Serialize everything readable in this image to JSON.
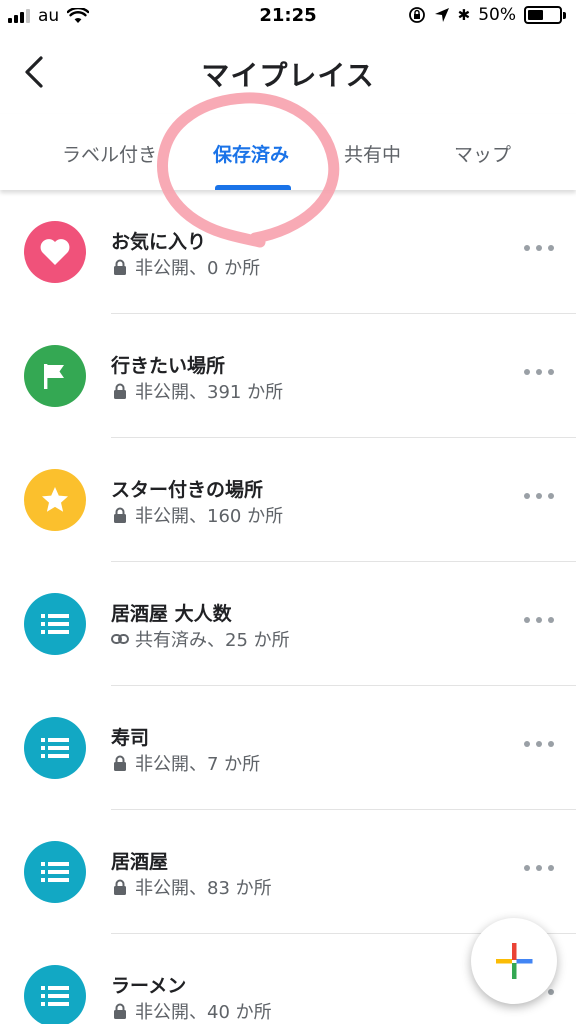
{
  "status_bar": {
    "carrier": "au",
    "time": "21:25",
    "battery_percent": "50%",
    "battery_level": 0.5
  },
  "header": {
    "title": "マイプレイス",
    "back_icon": "chevron-left-icon"
  },
  "tabs": [
    {
      "label": "ラベル付き",
      "active": false
    },
    {
      "label": "保存済み",
      "active": true
    },
    {
      "label": "共有中",
      "active": false
    },
    {
      "label": "マップ",
      "active": false
    }
  ],
  "colors": {
    "accent": "#1a73e8",
    "favorites": "#f0527a",
    "want_to_go": "#34a853",
    "starred": "#fbc02d",
    "custom_list": "#12a8c4",
    "annotation_circle": "#f7a1ad"
  },
  "lists": [
    {
      "title": "お気に入り",
      "subtitle": "非公開、0 か所",
      "icon": "heart-icon",
      "sub_icon": "lock-icon",
      "color": "#f0527a"
    },
    {
      "title": "行きたい場所",
      "subtitle": "非公開、391 か所",
      "icon": "flag-icon",
      "sub_icon": "lock-icon",
      "color": "#34a853"
    },
    {
      "title": "スター付きの場所",
      "subtitle": "非公開、160 か所",
      "icon": "star-icon",
      "sub_icon": "lock-icon",
      "color": "#fbc02d"
    },
    {
      "title": "居酒屋 大人数",
      "subtitle": "共有済み、25 か所",
      "icon": "list-icon",
      "sub_icon": "link-icon",
      "color": "#12a8c4"
    },
    {
      "title": "寿司",
      "subtitle": "非公開、7 か所",
      "icon": "list-icon",
      "sub_icon": "lock-icon",
      "color": "#12a8c4"
    },
    {
      "title": "居酒屋",
      "subtitle": "非公開、83 か所",
      "icon": "list-icon",
      "sub_icon": "lock-icon",
      "color": "#12a8c4"
    },
    {
      "title": "ラーメン",
      "subtitle": "非公開、40 か所",
      "icon": "list-icon",
      "sub_icon": "lock-icon",
      "color": "#12a8c4"
    }
  ],
  "fab": {
    "icon": "plus-icon"
  }
}
